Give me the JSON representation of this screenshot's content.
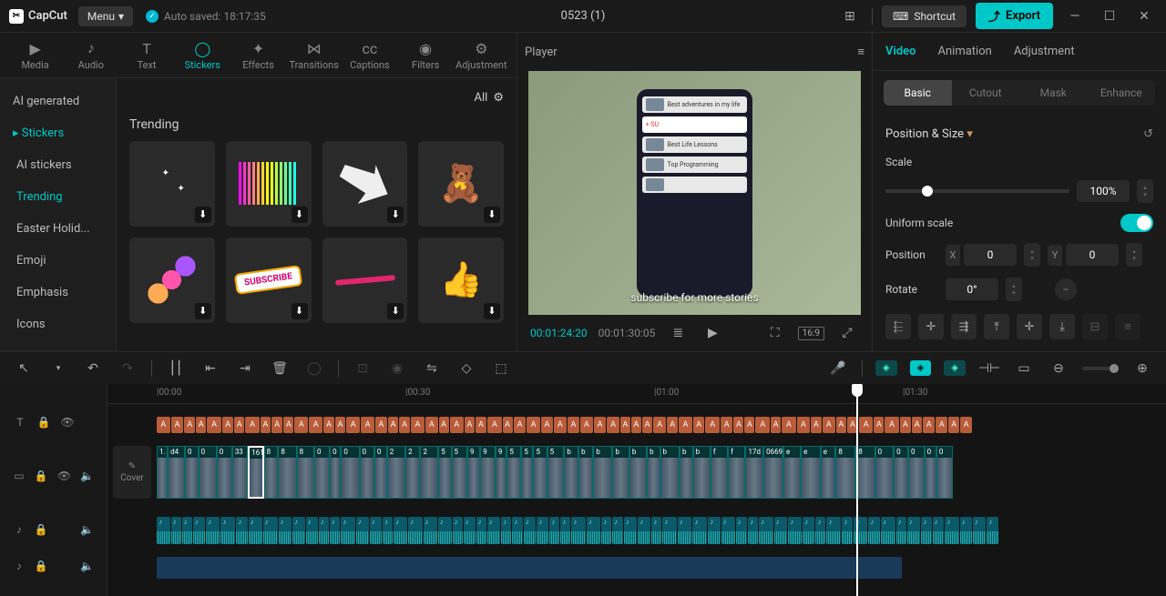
{
  "app": {
    "name": "CapCut",
    "menu": "Menu",
    "autosave": "Auto saved: 18:17:35",
    "title": "0523 (1)",
    "shortcut": "Shortcut",
    "export": "Export"
  },
  "mediaTabs": [
    "Media",
    "Audio",
    "Text",
    "Stickers",
    "Effects",
    "Transitions",
    "Captions",
    "Filters",
    "Adjustment"
  ],
  "mediaTabActive": "Stickers",
  "categories": [
    "AI generated",
    "Stickers",
    "AI stickers",
    "Trending",
    "Easter Holid...",
    "Emoji",
    "Emphasis",
    "Icons"
  ],
  "categoryActive": "Trending",
  "stickerHeader": {
    "all": "All"
  },
  "trendingTitle": "Trending",
  "player": {
    "label": "Player",
    "caption": "subscribe for more stories",
    "timeCurrent": "00:01:24:20",
    "timeDuration": "00:01:30:05",
    "ratio": "16:9"
  },
  "inspector": {
    "tabs": [
      "Video",
      "Animation",
      "Adjustment"
    ],
    "tabActive": "Video",
    "subtabs": [
      "Basic",
      "Cutout",
      "Mask",
      "Enhance"
    ],
    "subtabActive": "Basic",
    "section": "Position & Size",
    "scaleLabel": "Scale",
    "scaleValue": "100%",
    "uniformLabel": "Uniform scale",
    "positionLabel": "Position",
    "posX": "0",
    "posY": "0",
    "rotateLabel": "Rotate",
    "rotateValue": "0°"
  },
  "ruler": [
    "00:00",
    "00:30",
    "01:00",
    "01:30"
  ],
  "cover": "Cover",
  "videoClips": [
    "1.",
    "d4",
    "0",
    "0",
    "0",
    "33",
    "161",
    "8",
    "8",
    "8",
    "0",
    "0",
    "0",
    "0",
    "0",
    "2",
    "2",
    "2",
    "5",
    "5",
    "9",
    "9",
    "9",
    "5",
    "5",
    "5",
    "5",
    "b",
    "b",
    "b",
    "b",
    "b",
    "b",
    "b",
    "b",
    "b",
    "f",
    "f",
    "17d",
    "0669",
    "e",
    "e",
    "e",
    "8",
    "8",
    "0",
    "0",
    "0",
    "0",
    "0"
  ]
}
